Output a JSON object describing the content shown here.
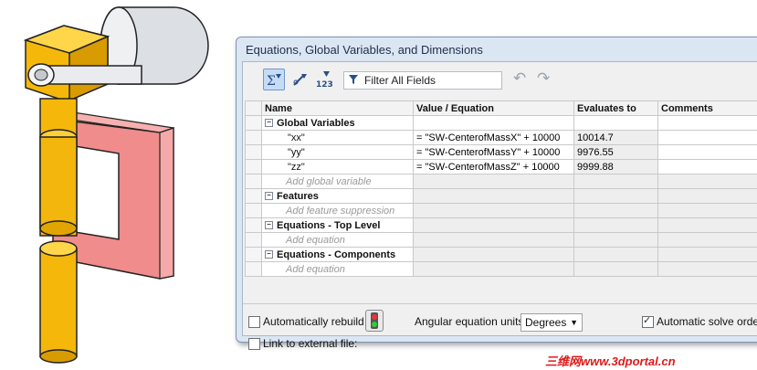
{
  "window": {
    "title": "Equations, Global Variables, and Dimensions"
  },
  "toolbar": {
    "filter_placeholder": "Filter All Fields",
    "buttons": [
      "equation-view-icon",
      "sketch-equation-view-icon",
      "ordered-view-icon"
    ],
    "undo_icon": "undo-icon",
    "redo_icon": "redo-icon"
  },
  "table": {
    "headers": [
      "Name",
      "Value / Equation",
      "Evaluates to",
      "Comments"
    ],
    "sections": {
      "global_variables": "Global Variables",
      "features": "Features",
      "equations_top": "Equations - Top Level",
      "equations_components": "Equations - Components"
    },
    "rows": [
      {
        "name": "\"xx\"",
        "value": "= \"SW-CenterofMassX\" + 10000",
        "evaluates": "10014.7",
        "comment": ""
      },
      {
        "name": "\"yy\"",
        "value": "= \"SW-CenterofMassY\" + 10000",
        "evaluates": "9976.55",
        "comment": ""
      },
      {
        "name": "\"zz\"",
        "value": "= \"SW-CenterofMassZ\" + 10000",
        "evaluates": "9999.88",
        "comment": ""
      }
    ],
    "placeholders": {
      "add_global_variable": "Add global variable",
      "add_feature_suppression": "Add feature suppression",
      "add_equation": "Add equation"
    }
  },
  "footer": {
    "auto_rebuild_label": "Automatically rebuild",
    "auto_rebuild_checked": false,
    "angular_units_label": "Angular equation units:",
    "angular_units_value": "Degrees",
    "auto_solve_label": "Automatic solve order",
    "auto_solve_checked": true,
    "link_external_label": "Link to external file:",
    "link_external_checked": false
  },
  "watermark": "三维网www.3dportal.cn",
  "colors": {
    "part_yellow": "#f2b90f",
    "part_pink": "#f08c8c",
    "dialog_frame": "#dbe6f3"
  }
}
